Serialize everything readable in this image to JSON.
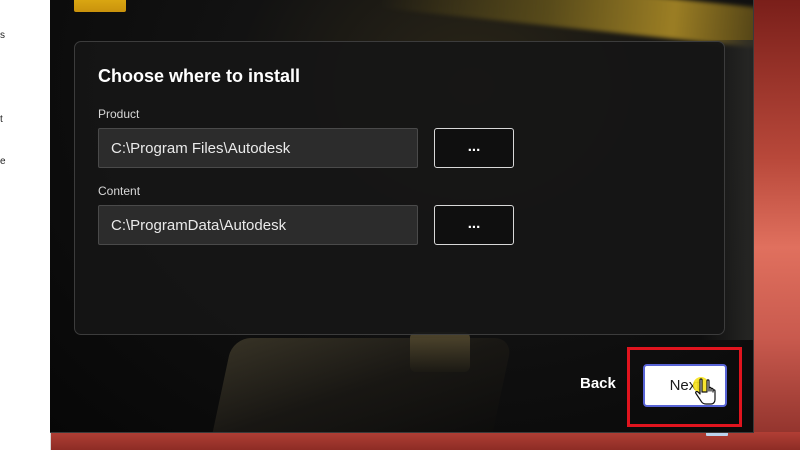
{
  "background_window": {
    "snippets": [
      "s",
      "t",
      "e"
    ]
  },
  "installer": {
    "panel": {
      "title": "Choose where to install",
      "product": {
        "label": "Product",
        "value": "C:\\Program Files\\Autodesk",
        "browse_label": "..."
      },
      "content": {
        "label": "Content",
        "value": "C:\\ProgramData\\Autodesk",
        "browse_label": "..."
      }
    },
    "footer": {
      "back_label": "Back",
      "next_label": "Next"
    }
  },
  "colors": {
    "accent_focus": "#5864d6",
    "highlight_annotation": "#e0141e",
    "brand_logo": "#f2c41a"
  },
  "icons": {
    "cursor": "hand-pointer-icon"
  }
}
